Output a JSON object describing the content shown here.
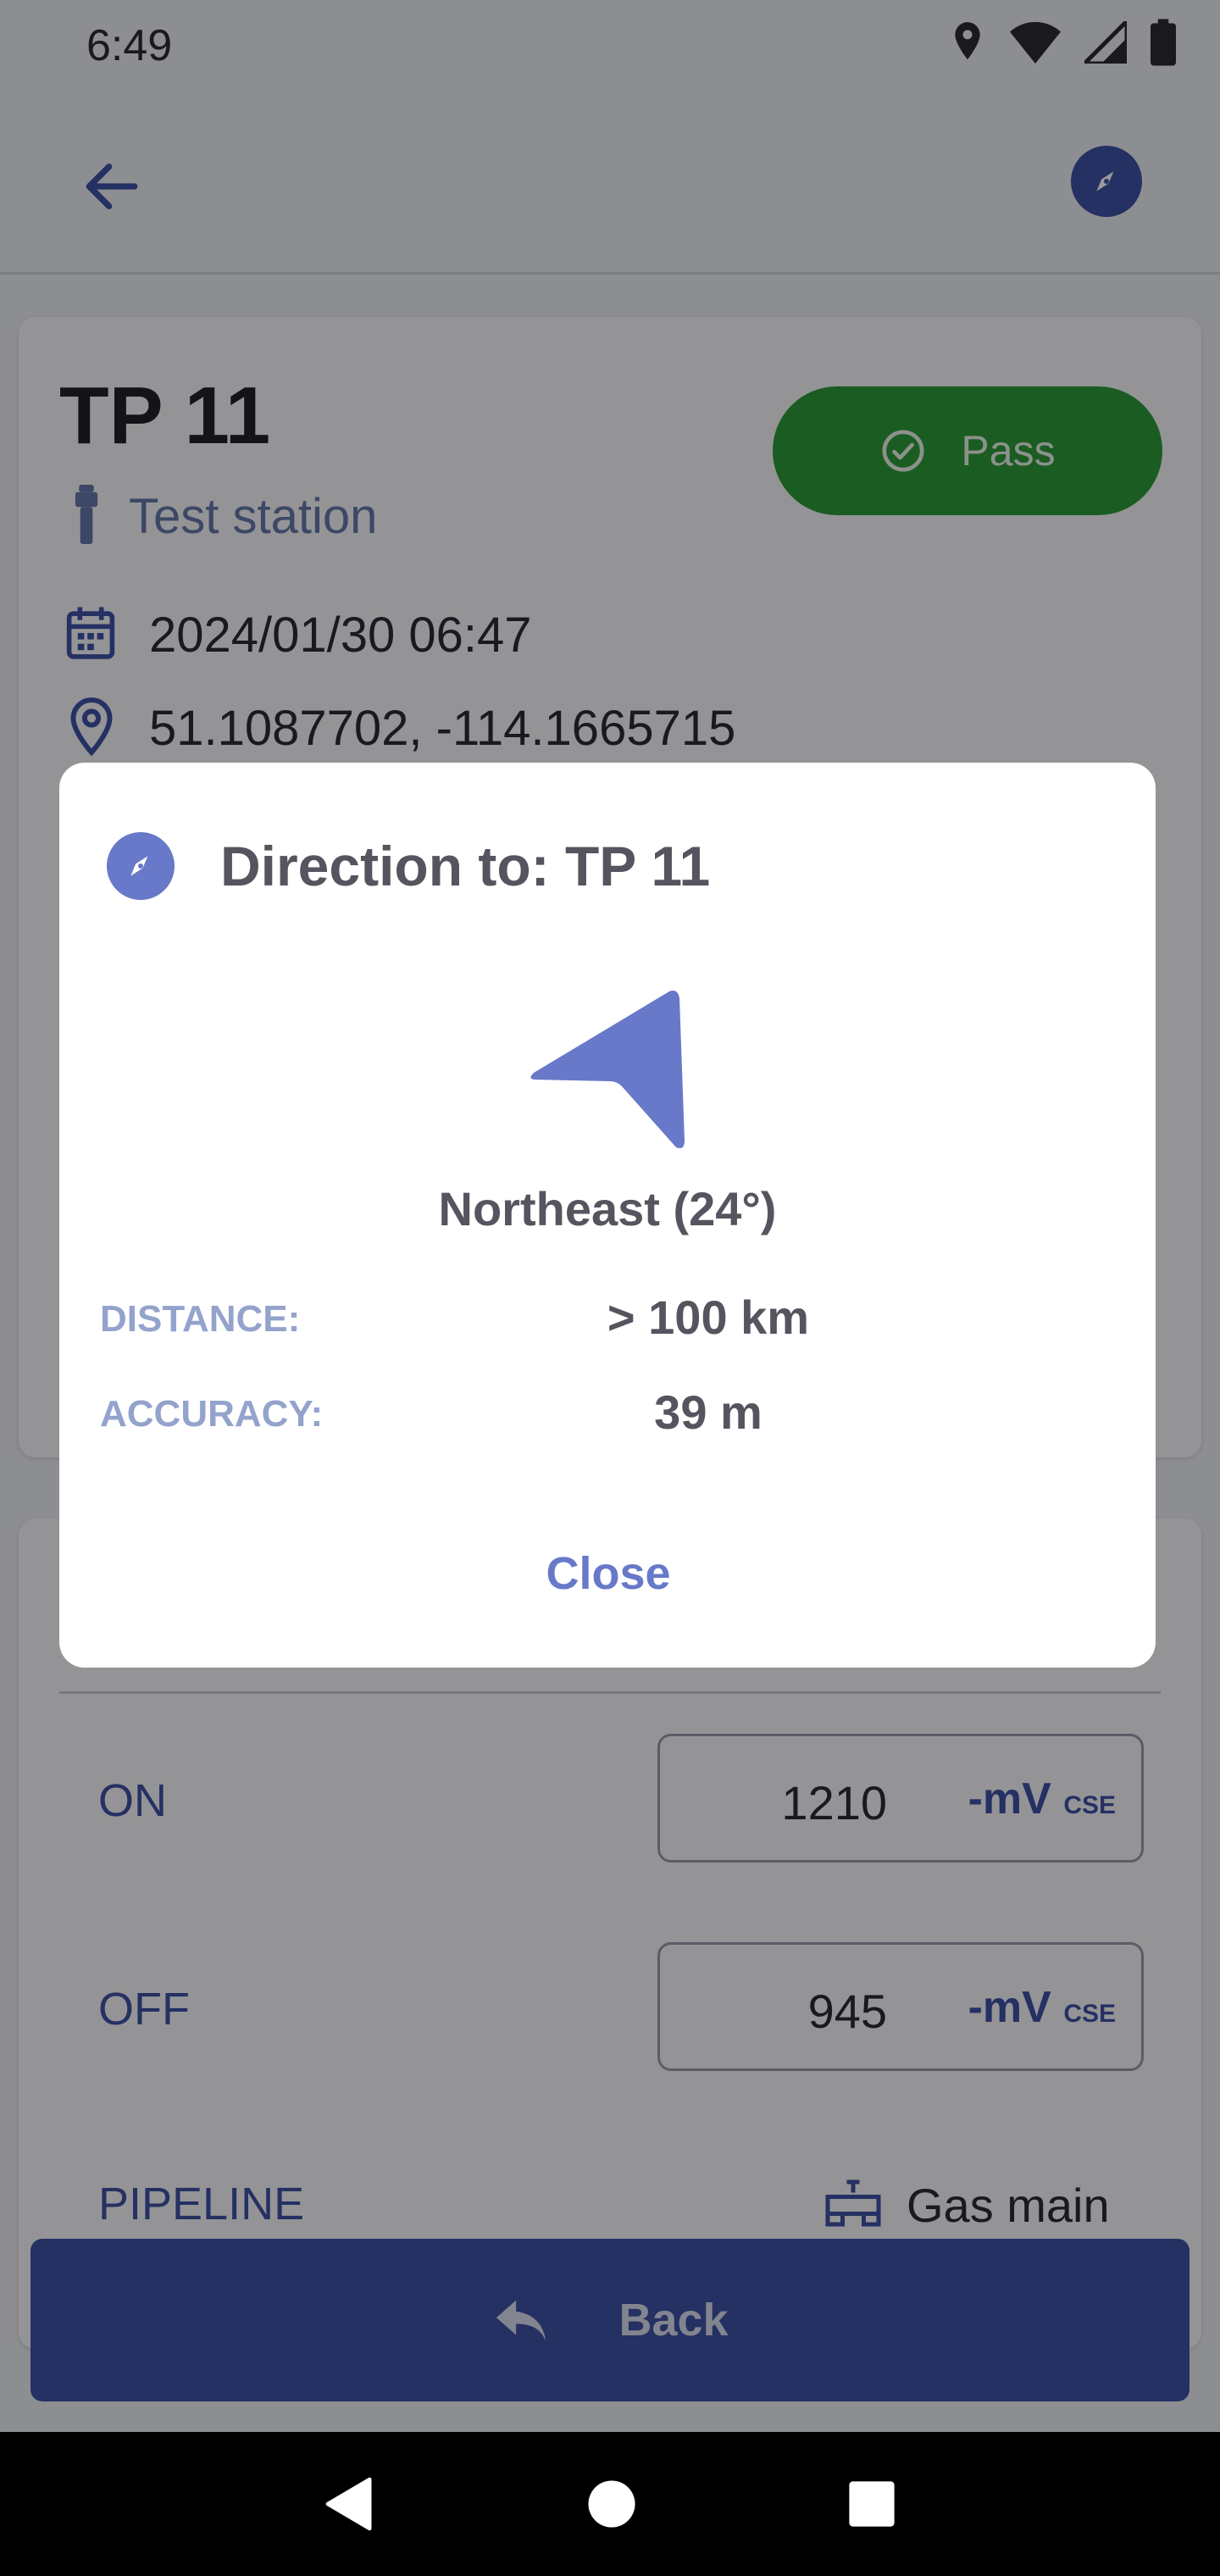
{
  "status_bar": {
    "time": "6:49"
  },
  "station": {
    "name": "TP 11",
    "type_label": "Test station",
    "status_button": "Pass",
    "date": "2024/01/30 06:47",
    "coordinates": "51.1087702, -114.1665715"
  },
  "readings": [
    {
      "label": "ON",
      "value": "1210",
      "unit": "-mV",
      "unit_sub": "CSE"
    },
    {
      "label": "OFF",
      "value": "945",
      "unit": "-mV",
      "unit_sub": "CSE"
    }
  ],
  "pipeline": {
    "label": "PIPELINE",
    "value": "Gas main"
  },
  "back_button": {
    "label": "Back"
  },
  "dialog": {
    "title": "Direction to: TP 11",
    "direction": "Northeast (24°)",
    "heading_degrees": 24,
    "distance_label": "DISTANCE:",
    "distance_value": "> 100 km",
    "accuracy_label": "ACCURACY:",
    "accuracy_value": "39 m",
    "close_label": "Close"
  },
  "colors": {
    "primary": "#3f51a5",
    "accent": "#6879c9",
    "pass": "#2e9a3a"
  }
}
